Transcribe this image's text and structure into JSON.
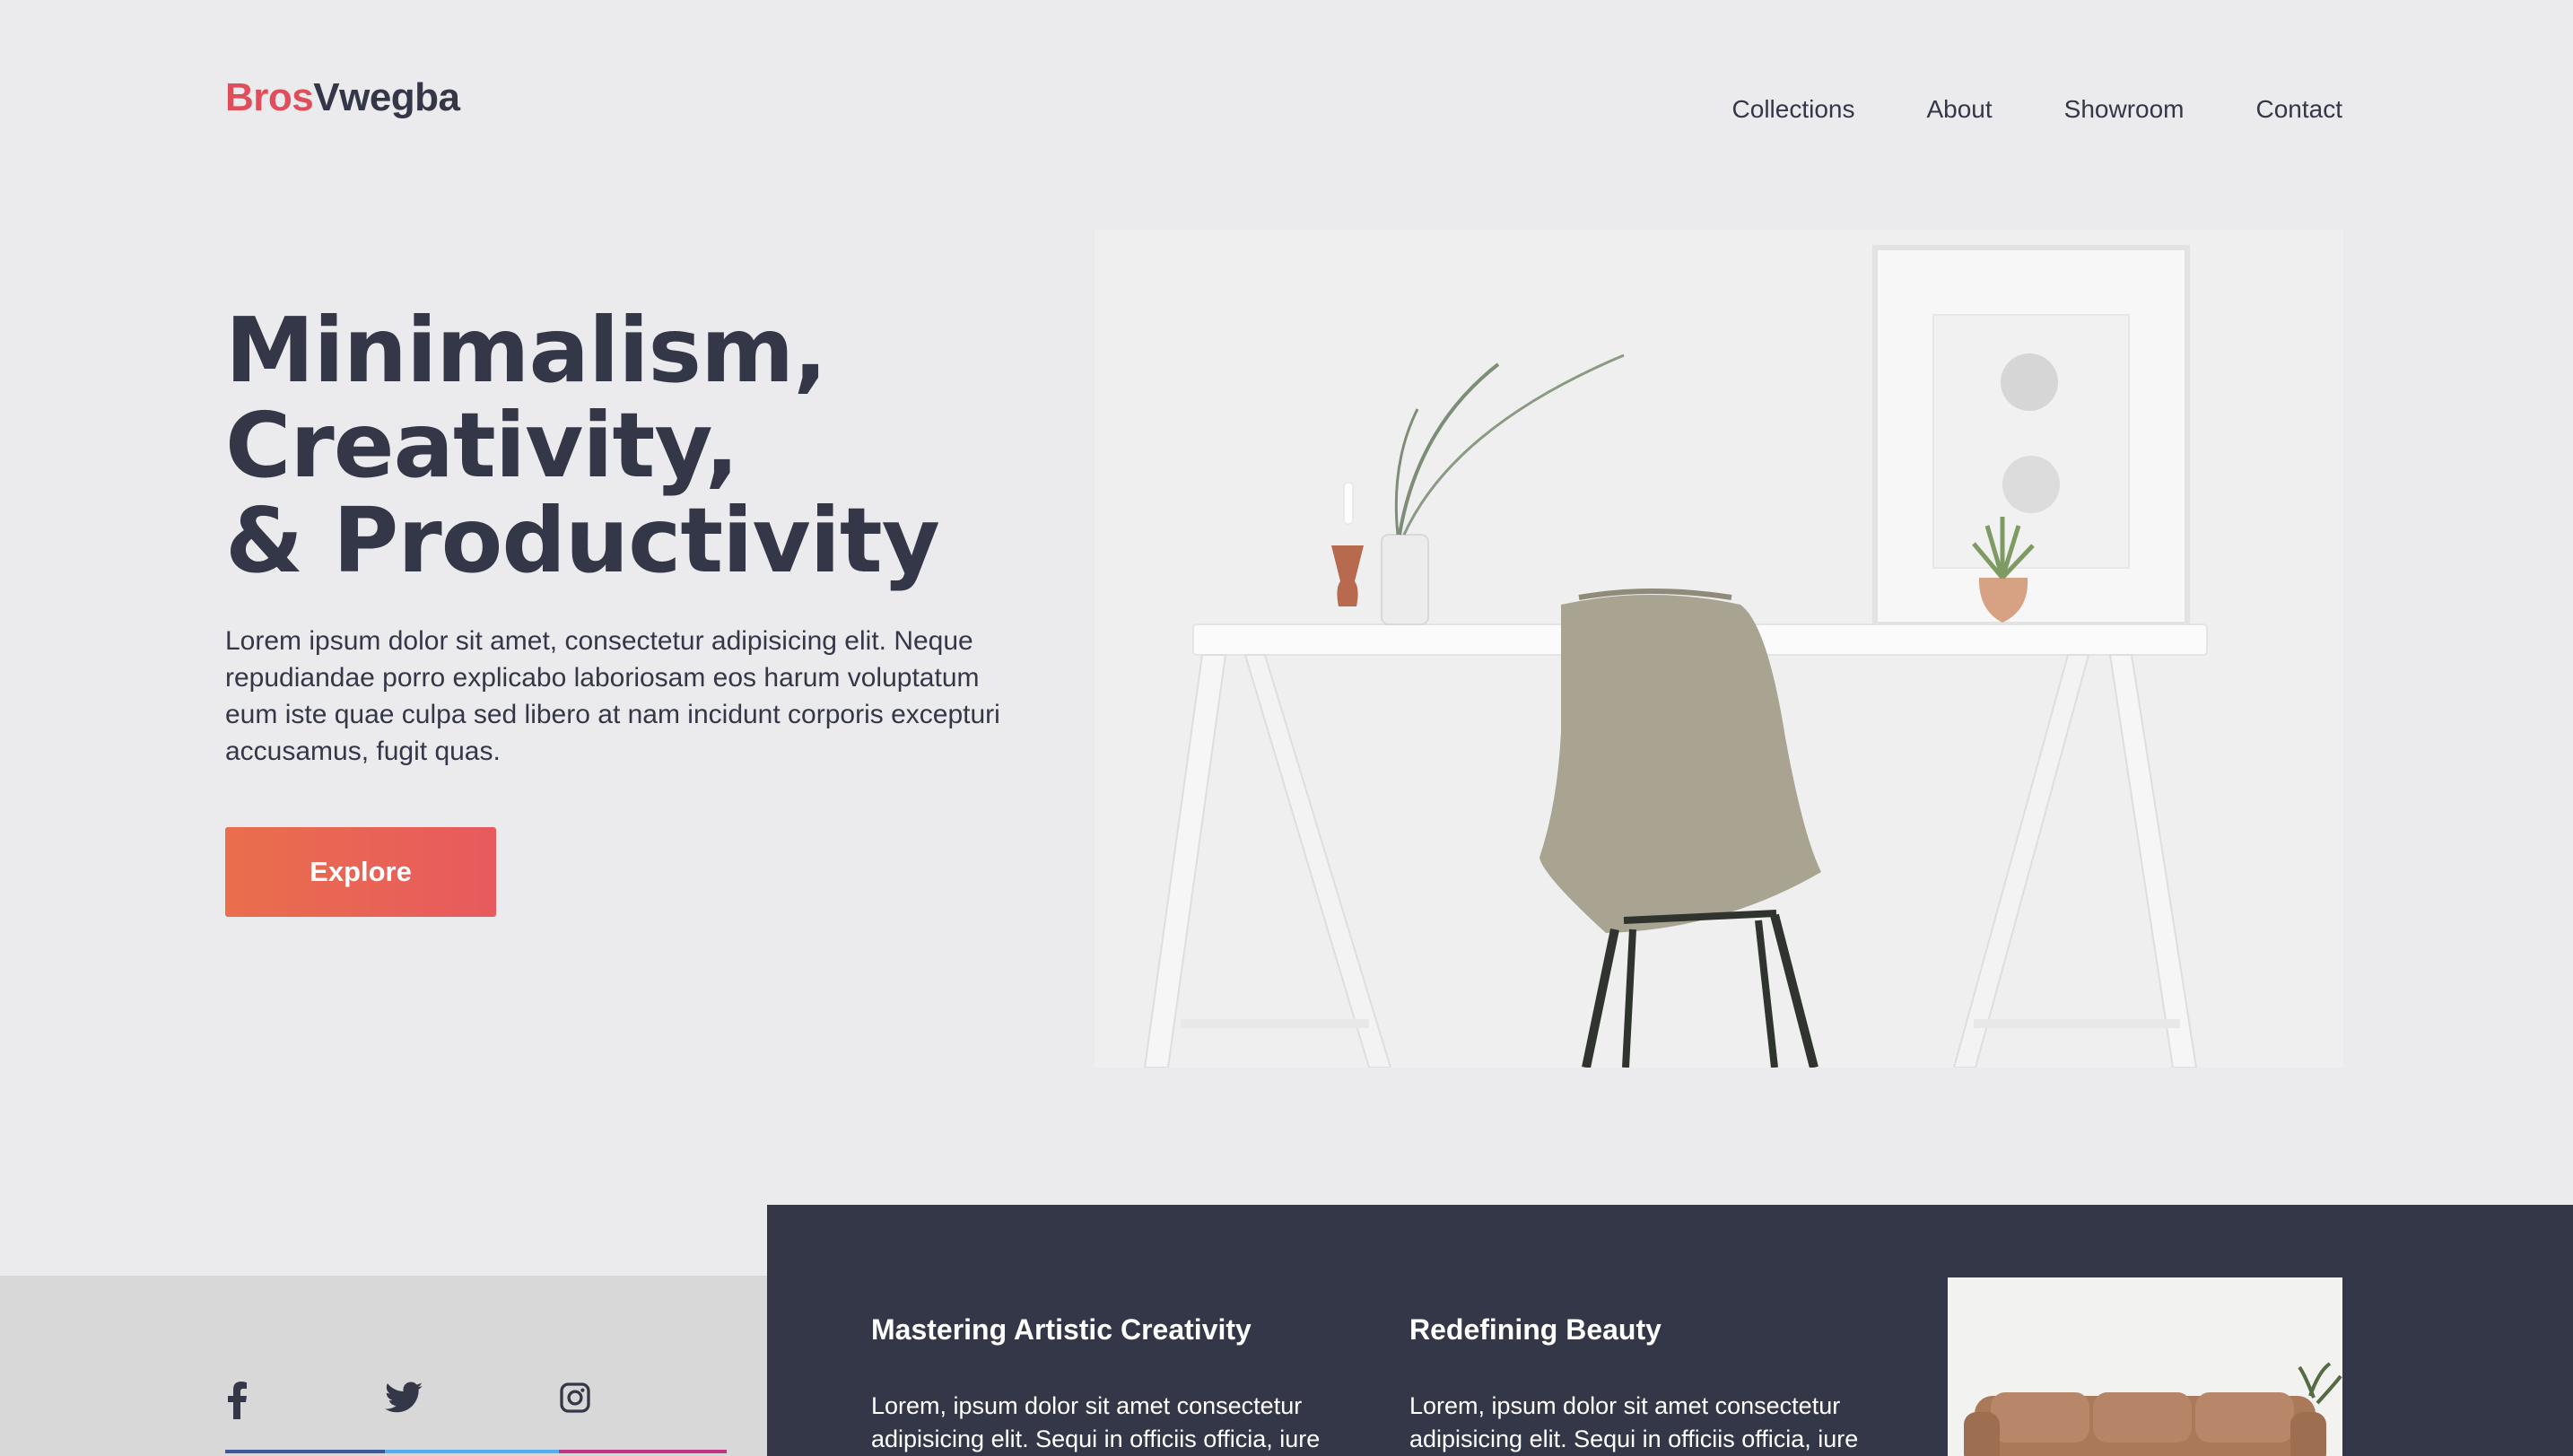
{
  "brand": {
    "part1": "Bros",
    "part2": "Vwegba"
  },
  "nav": {
    "items": [
      "Collections",
      "About",
      "Showroom",
      "Contact"
    ]
  },
  "hero": {
    "lines": [
      "Minimalism,",
      "Creativity,",
      "& Productivity"
    ],
    "body": "Lorem ipsum dolor sit amet, consectetur adipisicing elit. Neque repudiandae porro explicabo laboriosam eos harum voluptatum eum iste quae culpa sed libero at nam incidunt corporis excepturi accusamus, fugit quas.",
    "cta": "Explore"
  },
  "social": [
    {
      "icon": "facebook-icon",
      "color": "#3b5998"
    },
    {
      "icon": "twitter-icon",
      "color": "#55acee"
    },
    {
      "icon": "instagram-icon",
      "color": "#c13584"
    }
  ],
  "features": [
    {
      "title": "Mastering Artistic Creativity",
      "text": "Lorem, ipsum dolor sit amet consectetur adipisicing elit. Sequi in officiis officia, iure"
    },
    {
      "title": "Redefining Beauty",
      "text": "Lorem, ipsum dolor sit amet consectetur adipisicing elit. Sequi in officiis officia, iure"
    }
  ],
  "colors": {
    "accent": "#e04e5c",
    "dark": "#343747",
    "background": "#ebebed",
    "cta_start": "#ea6e4c",
    "cta_end": "#e75a5e"
  }
}
